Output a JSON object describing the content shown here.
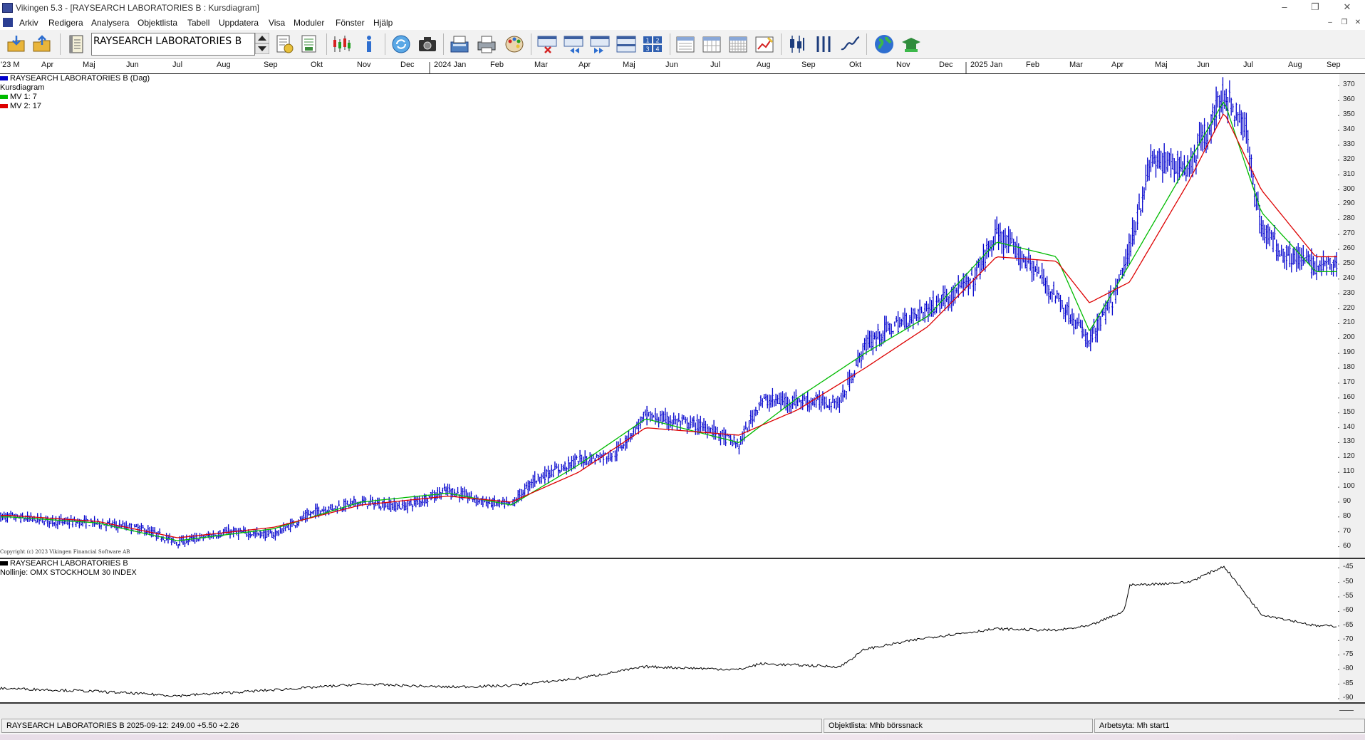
{
  "window": {
    "title": "Vikingen 5.3 - [RAYSEARCH LABORATORIES B : Kursdiagram]",
    "minimize_glyph": "–",
    "maximize_glyph": "❐",
    "close_glyph": "✕"
  },
  "menu": [
    {
      "label": "Arkiv"
    },
    {
      "label": "Redigera"
    },
    {
      "label": "Analysera"
    },
    {
      "label": "Objektlista"
    },
    {
      "label": "Tabell"
    },
    {
      "label": "Uppdatera"
    },
    {
      "label": "Visa"
    },
    {
      "label": "Moduler"
    },
    {
      "label": "Fönster"
    },
    {
      "label": "Hjälp"
    }
  ],
  "toolbar": {
    "symbol_value": "RAYSEARCH LABORATORIES B",
    "icons": [
      "open-folder-icon",
      "export-folder-icon",
      "notebook-icon",
      "edit-list-icon",
      "report-icon",
      "candlestick-colors-icon",
      "info-icon",
      "refresh-icon",
      "camera-icon",
      "fax-icon",
      "printer-icon",
      "palette-icon",
      "window-close-icon",
      "step-back-icon",
      "step-forward-icon",
      "window-layout-icon",
      "number-grid-icon",
      "calendar-day-icon",
      "calendar-week-icon",
      "calendar-month-icon",
      "chart-settings-icon",
      "candlestick-icon",
      "bar-chart-icon",
      "line-chart-icon",
      "globe-icon",
      "mortarboard-icon"
    ]
  },
  "time_axis": [
    "'23 M",
    "Apr",
    "Maj",
    "Jun",
    "Jul",
    "Aug",
    "Sep",
    "Okt",
    "Nov",
    "Dec",
    "2024 Jan",
    "Feb",
    "Mar",
    "Apr",
    "Maj",
    "Jun",
    "Jul",
    "Aug",
    "Sep",
    "Okt",
    "Nov",
    "Dec",
    "2025 Jan",
    "Feb",
    "Mar",
    "Apr",
    "Maj",
    "Jun",
    "Jul",
    "Aug",
    "Sep"
  ],
  "legend": {
    "series_name": "RAYSEARCH LABORATORIES B (Dag)",
    "chart_name": "Kursdiagram",
    "mv1": "MV 1: 7",
    "mv2": "MV 2: 17",
    "copyright": "Copyright (c) 2023 Vikingen Financial Software AB",
    "rs_series": "RAYSEARCH LABORATORIES B",
    "rs_baseline": "Nollinje: OMX STOCKHOLM 30 INDEX"
  },
  "colors": {
    "price_bars": "#0000cc",
    "mv1": "#00bb00",
    "mv2": "#dd0000",
    "rs_line": "#000000"
  },
  "chart_data": [
    {
      "type": "line",
      "title": "RAYSEARCH LABORATORIES B (Dag)",
      "subtitle": "Kursdiagram",
      "x_range": [
        "2023-03",
        "2025-09"
      ],
      "ylim": [
        55,
        375
      ],
      "yticks": [
        60,
        70,
        80,
        90,
        100,
        110,
        120,
        130,
        140,
        150,
        160,
        170,
        180,
        190,
        200,
        210,
        220,
        230,
        240,
        250,
        260,
        270,
        280,
        290,
        300,
        310,
        320,
        330,
        340,
        350,
        360,
        370
      ],
      "series": [
        {
          "name": "RAYSEARCH LABORATORIES B (Dag)",
          "style": "ohlc",
          "x": [
            "2023-03-15",
            "2023-04-15",
            "2023-05-15",
            "2023-06-15",
            "2023-07-10",
            "2023-08-15",
            "2023-09-15",
            "2023-10-15",
            "2023-11-15",
            "2023-12-15",
            "2024-01-15",
            "2024-02-10",
            "2024-02-28",
            "2024-03-15",
            "2024-04-15",
            "2024-05-10",
            "2024-06-01",
            "2024-07-15",
            "2024-08-05",
            "2024-08-20",
            "2024-09-15",
            "2024-10-15",
            "2024-11-01",
            "2024-11-15",
            "2024-12-15",
            "2025-01-15",
            "2025-02-01",
            "2025-02-25",
            "2025-03-15",
            "2025-04-07",
            "2025-04-25",
            "2025-05-05",
            "2025-05-20",
            "2025-06-15",
            "2025-07-01",
            "2025-07-10",
            "2025-07-25",
            "2025-08-05",
            "2025-08-20",
            "2025-09-12"
          ],
          "values": [
            80,
            77,
            76,
            72,
            63,
            70,
            68,
            84,
            90,
            87,
            98,
            90,
            88,
            105,
            118,
            122,
            148,
            140,
            128,
            158,
            158,
            157,
            195,
            205,
            220,
            238,
            270,
            250,
            228,
            198,
            230,
            260,
            320,
            315,
            345,
            365,
            340,
            275,
            258,
            249
          ]
        },
        {
          "name": "MV 1: 7",
          "x": [
            "2023-03-15",
            "2023-05-15",
            "2023-07-10",
            "2023-09-15",
            "2023-11-15",
            "2024-01-15",
            "2024-02-28",
            "2024-04-15",
            "2024-06-01",
            "2024-08-05",
            "2024-09-15",
            "2024-11-01",
            "2024-12-15",
            "2025-02-01",
            "2025-03-15",
            "2025-04-07",
            "2025-05-05",
            "2025-06-15",
            "2025-07-10",
            "2025-08-05",
            "2025-09-12"
          ],
          "values": [
            80,
            76,
            64,
            72,
            90,
            96,
            88,
            115,
            146,
            130,
            160,
            190,
            215,
            265,
            255,
            205,
            250,
            318,
            360,
            285,
            245
          ]
        },
        {
          "name": "MV 2: 17",
          "x": [
            "2023-03-15",
            "2023-05-15",
            "2023-07-10",
            "2023-09-15",
            "2023-11-15",
            "2024-01-15",
            "2024-02-28",
            "2024-04-15",
            "2024-06-01",
            "2024-08-05",
            "2024-09-15",
            "2024-11-01",
            "2024-12-15",
            "2025-02-01",
            "2025-03-15",
            "2025-04-07",
            "2025-05-05",
            "2025-06-15",
            "2025-07-10",
            "2025-08-05",
            "2025-09-12"
          ],
          "values": [
            81,
            77,
            66,
            73,
            88,
            94,
            90,
            110,
            140,
            135,
            152,
            180,
            208,
            255,
            252,
            224,
            238,
            305,
            352,
            300,
            255
          ]
        }
      ]
    },
    {
      "type": "line",
      "title": "RAYSEARCH LABORATORIES B",
      "subtitle": "Nollinje: OMX STOCKHOLM 30 INDEX",
      "ylim": [
        -90,
        -43
      ],
      "yticks": [
        -90,
        -85,
        -80,
        -75,
        -70,
        -65,
        -60,
        -55,
        -50,
        -45
      ],
      "series": [
        {
          "name": "RAYSEARCH LABORATORIES B",
          "x": [
            "2023-03-15",
            "2023-05-15",
            "2023-07-10",
            "2023-09-15",
            "2023-11-15",
            "2024-01-15",
            "2024-02-28",
            "2024-04-15",
            "2024-06-01",
            "2024-08-05",
            "2024-08-20",
            "2024-10-15",
            "2024-11-01",
            "2024-12-15",
            "2025-02-01",
            "2025-03-15",
            "2025-04-07",
            "2025-05-01",
            "2025-05-05",
            "2025-06-15",
            "2025-07-10",
            "2025-08-05",
            "2025-08-25",
            "2025-09-12"
          ],
          "values": [
            -86.5,
            -87.5,
            -89,
            -87,
            -85,
            -86,
            -85.5,
            -83,
            -79,
            -80,
            -78,
            -79,
            -73,
            -69,
            -66,
            -66.5,
            -65,
            -60,
            -51,
            -50,
            -44.5,
            -61,
            -63,
            -65
          ]
        }
      ]
    }
  ],
  "status": {
    "quote": "RAYSEARCH LABORATORIES B 2025-09-12:  249.00    +5.50    +2.26",
    "objectlist": "Objektlista: Mhb börssnack",
    "workspace": "Arbetsyta: Mh start1"
  }
}
